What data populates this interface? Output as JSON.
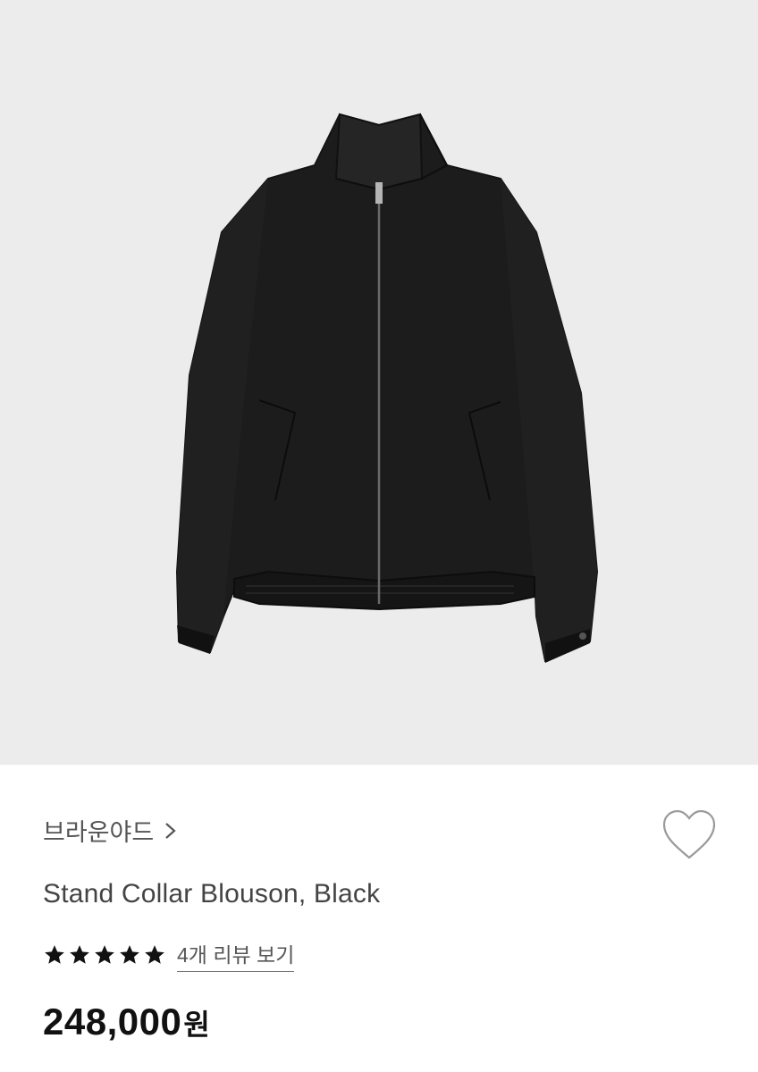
{
  "product_image": {
    "alt": "",
    "icon": "jacket-photo",
    "background": "#ececec"
  },
  "brand": {
    "name": "브라운야드",
    "chevron_icon": "chevron-right-icon"
  },
  "wishlist": {
    "icon": "heart-outline-icon"
  },
  "product": {
    "name": "Stand Collar Blouson, Black"
  },
  "rating": {
    "stars": 5,
    "max_stars": 5,
    "review_link": "4개 리뷰 보기"
  },
  "price": {
    "amount": "248,000",
    "unit": "원"
  },
  "colors": {
    "text_primary": "#111111",
    "text_secondary": "#555555",
    "star": "#111111",
    "heart_stroke": "#9a9a9a"
  }
}
